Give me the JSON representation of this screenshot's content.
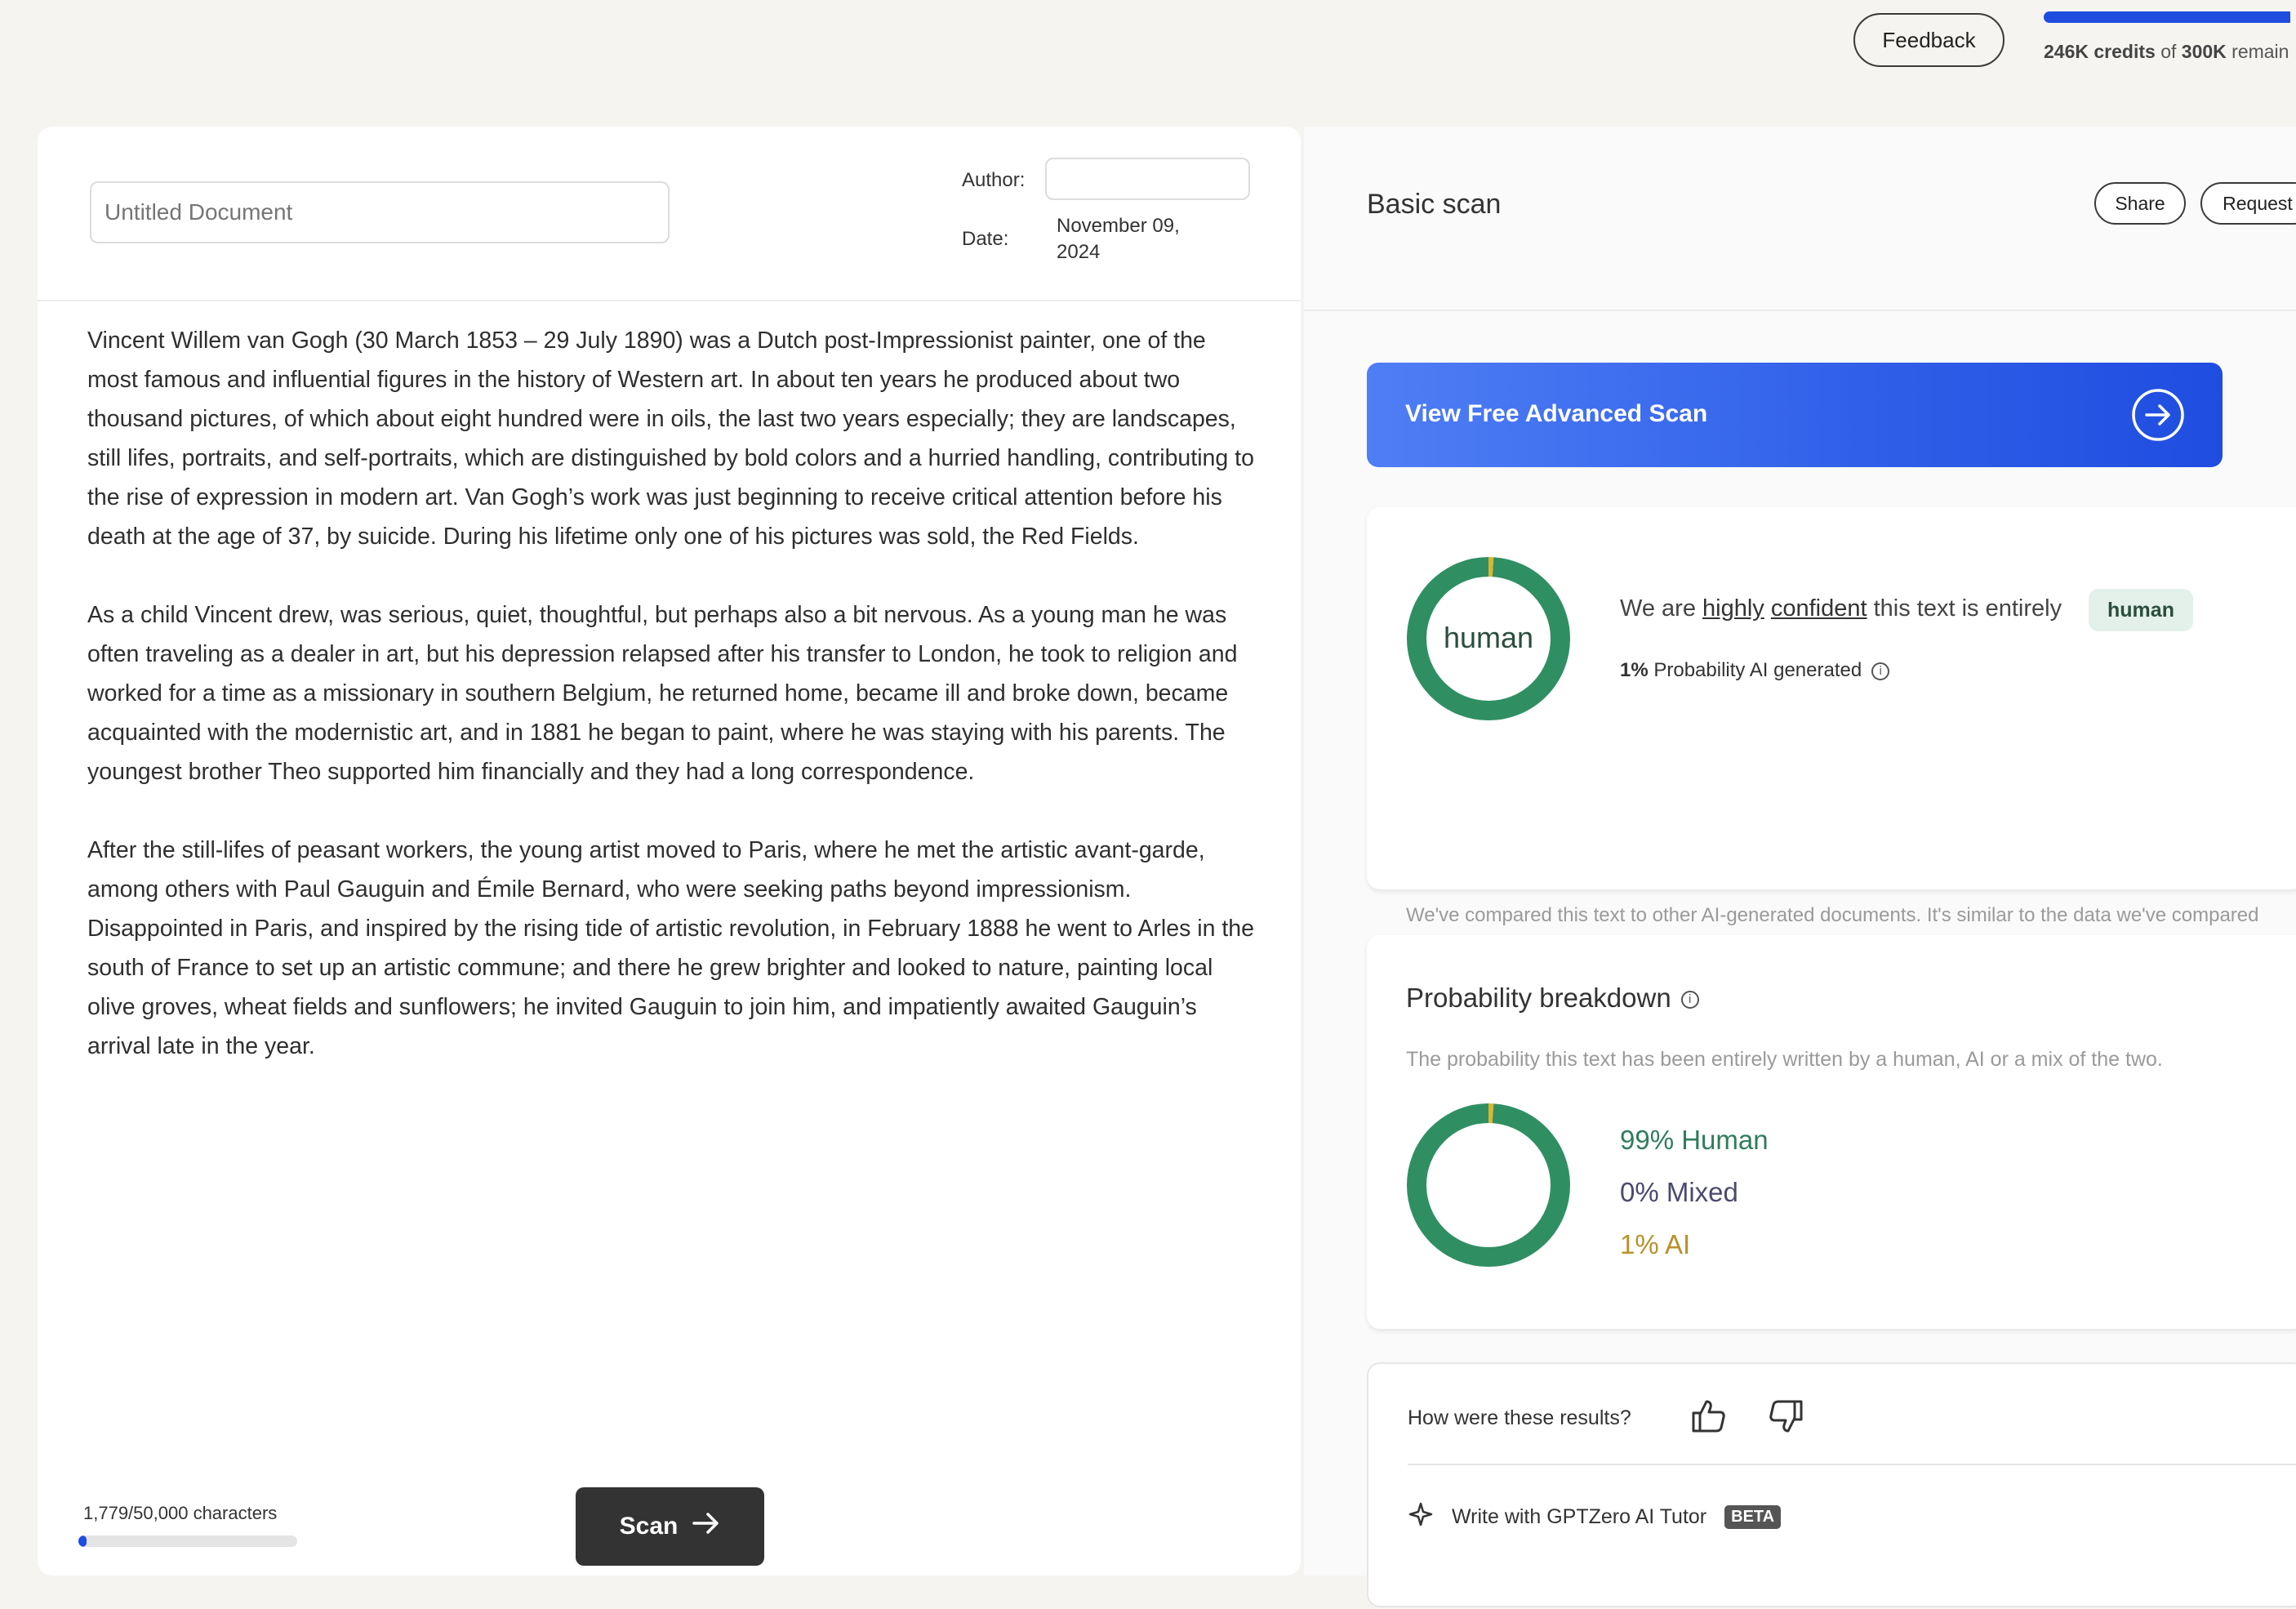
{
  "topbar": {
    "feedback_label": "Feedback",
    "credits_used": "246K credits",
    "credits_rest": " of ",
    "credits_total": "300K",
    "credits_suffix": " remain",
    "credits_fraction": 0.82
  },
  "document": {
    "title_placeholder": "Untitled Document",
    "author_label": "Author:",
    "author_value": "",
    "date_label": "Date:",
    "date_value": "November 09, 2024",
    "paragraphs": [
      "Vincent Willem van Gogh (30 March 1853 – 29 July 1890) was a Dutch post-Impressionist painter, one of the most famous and influential figures in the history of Western art. In about ten years he produced about two thousand pictures, of which about eight hundred were in oils, the last two years especially; they are landscapes, still lifes, portraits, and self-portraits, which are distinguished by bold colors and a hurried handling, contributing to the rise of expression in modern art. Van Gogh’s work was just beginning to receive critical attention before his death at the age of 37, by suicide. During his lifetime only one of his pictures was sold, the Red Fields.",
      "As a child Vincent drew, was serious, quiet, thoughtful, but perhaps also a bit nervous. As a young man he was often traveling as a dealer in art, but his depression relapsed after his transfer to London, he took to religion and worked for a time as a missionary in southern Belgium, he returned home, became ill and broke down, became acquainted with the modernistic art, and in 1881 he began to paint, where he was staying with his parents. The youngest brother Theo supported him financially and they had a long correspondence.",
      "After the still-lifes of peasant workers, the young artist moved to Paris, where he met the artistic avant-garde, among others with Paul Gauguin and Émile Bernard, who were seeking paths beyond impressionism. Disappointed in Paris, and inspired by the rising tide of artistic revolution, in February 1888 he went to Arles in the south of France to set up an artistic commune; and there he grew brighter and looked to nature, painting local olive groves, wheat fields and sunflowers; he invited Gauguin to join him, and impatiently awaited Gauguin’s arrival late in the year."
    ],
    "char_count_label": "1,779/50,000 characters",
    "char_fraction": 0.0356,
    "scan_label": "Scan"
  },
  "results": {
    "header_title": "Basic scan",
    "share_label": "Share",
    "request_label": "Request",
    "advanced_scan_label": "View Free Advanced Scan",
    "verdict_donut_label": "human",
    "confidence_prefix": "We are ",
    "confidence_word1": "highly",
    "confidence_word2": "confident",
    "confidence_suffix": " this text is entirely",
    "verdict_tag": "human",
    "prob_value": "1%",
    "prob_text": " Probability AI generated",
    "compare_text": "We've compared this text to other AI-generated documents. It's similar to the data we've compared it to.",
    "breakdown_title": "Probability breakdown",
    "breakdown_desc": "The probability this text has been entirely written by a human, AI or a mix of the two.",
    "human_label": "99% Human",
    "mixed_label": "0% Mixed",
    "ai_label": "1% AI",
    "human_pct": 99,
    "mixed_pct": 0,
    "ai_pct": 1,
    "feedback_question": "How were these results?",
    "tutor_label": "Write with GPTZero AI Tutor",
    "beta_label": "BETA"
  },
  "colors": {
    "accent_blue": "#1f4de0",
    "human_green": "#2f8f63",
    "ai_gold": "#d9b531",
    "mixed_purple": "#4a4a6e"
  }
}
